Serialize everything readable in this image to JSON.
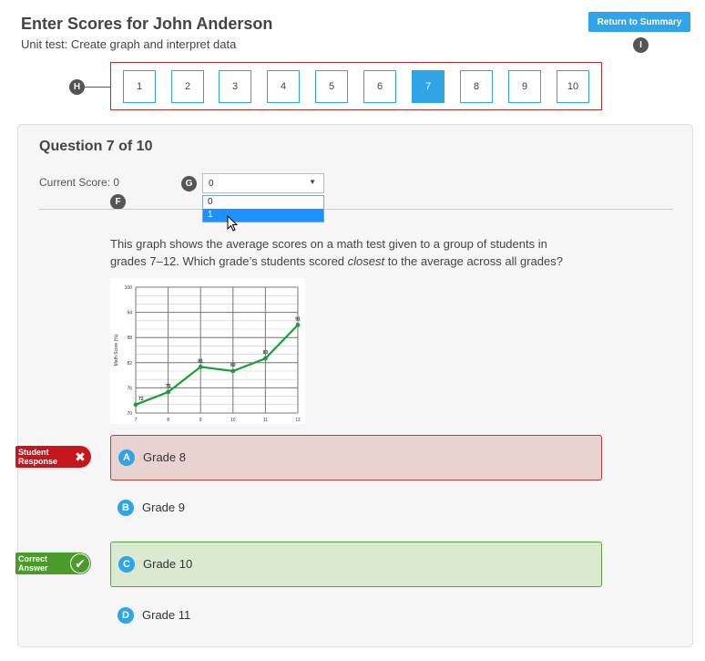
{
  "header": {
    "title": "Enter Scores for John Anderson",
    "subtitle": "Unit test: Create graph and interpret data",
    "return_label": "Return to Summary"
  },
  "markers": {
    "h": "H",
    "i": "I",
    "g": "G",
    "f": "F"
  },
  "question_nav": [
    "1",
    "2",
    "3",
    "4",
    "5",
    "6",
    "7",
    "8",
    "9",
    "10"
  ],
  "active_question": "7",
  "question": {
    "title": "Question 7 of 10",
    "score_label": "Current Score:",
    "score_value": "0",
    "text_line1": "This graph shows the average scores on a math test given to a group of students in",
    "text_line2_before": "grades 7–12. Which grade’s students scored ",
    "text_line2_em": "closest",
    "text_line2_after": " to the average across all grades?"
  },
  "score_select": {
    "value": "0",
    "options": [
      "0",
      "1"
    ],
    "highlighted": "1"
  },
  "chart_data": {
    "type": "line",
    "x": [
      7,
      8,
      9,
      10,
      11,
      12
    ],
    "values": [
      72,
      75,
      81,
      80,
      83,
      91
    ],
    "data_labels": [
      "72",
      "75",
      "81",
      "80",
      "83",
      "91"
    ],
    "ylabel": "Math Score (%)",
    "xlabel": "",
    "ylim": [
      70,
      100
    ],
    "y_ticks": [
      "70",
      "76",
      "82",
      "88",
      "94",
      "100"
    ],
    "x_ticks": [
      "7",
      "8",
      "9",
      "10",
      "11",
      "12"
    ],
    "grid": true,
    "line_color": "#1e9c3a"
  },
  "answers": [
    {
      "letter": "A",
      "label": "Grade 8",
      "state": "student"
    },
    {
      "letter": "B",
      "label": "Grade 9",
      "state": "none"
    },
    {
      "letter": "C",
      "label": "Grade 10",
      "state": "correct"
    },
    {
      "letter": "D",
      "label": "Grade 11",
      "state": "none"
    }
  ],
  "tags": {
    "student_line1": "Student",
    "student_line2": "Response",
    "correct_line1": "Correct",
    "correct_line2": "Answer"
  },
  "colors": {
    "accent": "#2fa4e7",
    "wrong": "#c4161c",
    "right": "#4a9a2c"
  }
}
